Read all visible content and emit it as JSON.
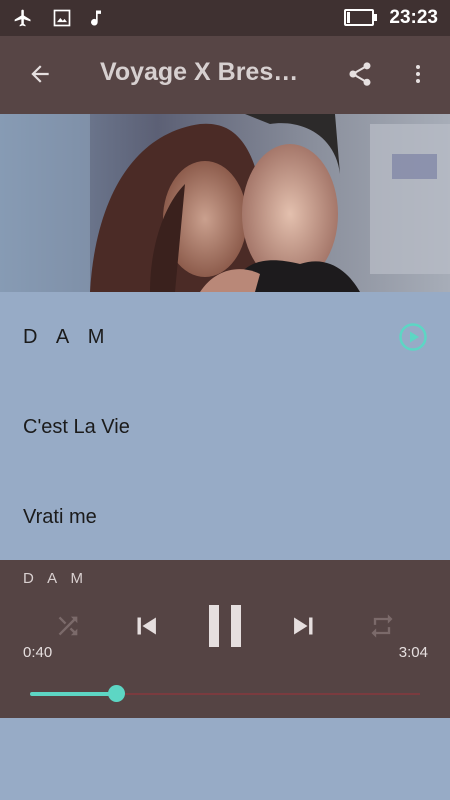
{
  "status_bar": {
    "time": "23:23",
    "icons": [
      "airplane-icon",
      "image-icon",
      "music-note-icon",
      "battery-icon"
    ],
    "battery_level": 0.1
  },
  "app_bar": {
    "title": "Voyage X Bres…",
    "icons": [
      "back-arrow-icon",
      "share-icon",
      "more-vert-icon"
    ]
  },
  "songs": [
    {
      "title": "D A M",
      "playing": true
    },
    {
      "title": "C'est La Vie"
    },
    {
      "title": "Vrati me"
    }
  ],
  "player": {
    "now_playing": "D A M",
    "elapsed": "0:40",
    "duration": "3:04",
    "progress": 0.22,
    "controls": [
      "shuffle-icon",
      "previous-icon",
      "pause-icon",
      "next-icon",
      "repeat-icon"
    ]
  },
  "colors": {
    "accent": "#5dd6c4",
    "status_bar": "#3f3131",
    "app_bar": "#574545",
    "player": "#554444",
    "list_bg": "#97abc6"
  }
}
